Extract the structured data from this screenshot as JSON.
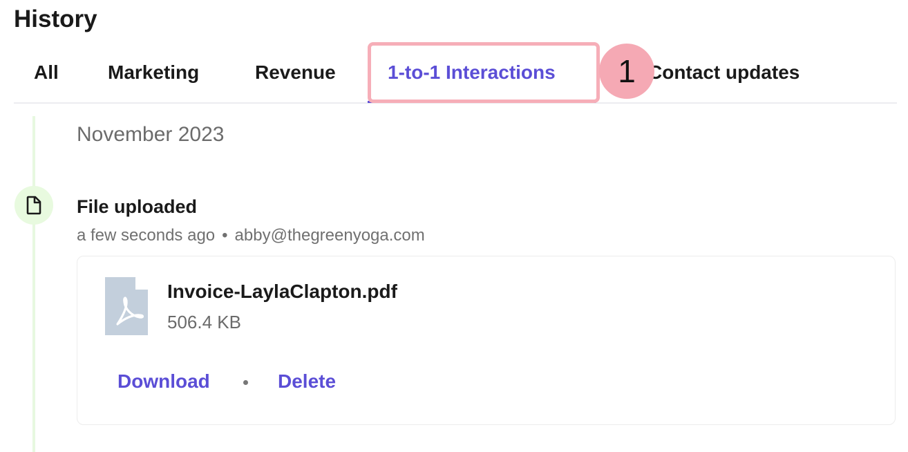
{
  "page": {
    "title": "History"
  },
  "tabs": [
    {
      "label": "All"
    },
    {
      "label": "Marketing"
    },
    {
      "label": "Revenue"
    },
    {
      "label": "1-to-1 Interactions",
      "active": true
    },
    {
      "label": "Contact updates"
    }
  ],
  "annotation": {
    "step_number": "1"
  },
  "timeline": {
    "month": "November 2023",
    "event": {
      "icon": "file-icon",
      "title": "File uploaded",
      "time": "a few seconds ago",
      "separator": "•",
      "user": "abby@thegreenyoga.com",
      "file": {
        "icon": "pdf-file-icon",
        "name": "Invoice-LaylaClapton.pdf",
        "size": "506.4 KB"
      },
      "actions": {
        "download": "Download",
        "delete": "Delete"
      }
    }
  },
  "colors": {
    "accent": "#5b4ed6",
    "highlight": "#f6aeb8",
    "badge": "#f5a9b4",
    "timeline": "#e7f8e0"
  }
}
